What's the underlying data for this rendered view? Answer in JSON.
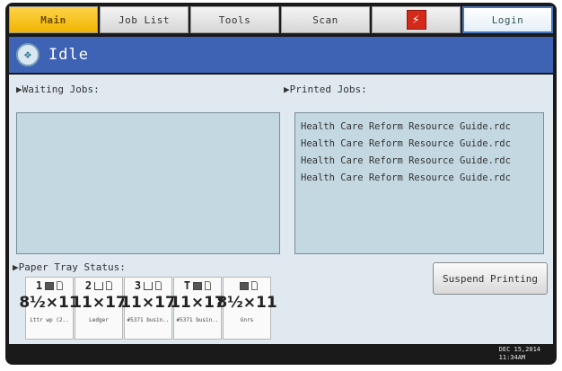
{
  "tabs": [
    {
      "label": "Main",
      "active": true
    },
    {
      "label": "Job List"
    },
    {
      "label": "Tools"
    },
    {
      "label": "Scan"
    },
    {
      "label": "",
      "icon": "alert-icon"
    },
    {
      "label": "Login"
    }
  ],
  "status": {
    "text": "Idle",
    "icon": "printer-status-icon"
  },
  "waiting_jobs": {
    "label": "▶Waiting Jobs:"
  },
  "printed_jobs": {
    "label": "▶Printed Jobs:",
    "items": [
      "Health Care Reform Resource Guide.rdc",
      "Health Care Reform Resource Guide.rdc",
      "Health Care Reform Resource Guide.rdc",
      "Health Care Reform Resource Guide.rdc"
    ]
  },
  "paper_tray": {
    "label": "▶Paper Tray Status:",
    "trays": [
      {
        "num": "1",
        "size": "8½×11",
        "type": "Lttr wp (2.."
      },
      {
        "num": "2",
        "size": "11×17",
        "type": "Ledger"
      },
      {
        "num": "3",
        "size": "11×17",
        "type": "#5371 busin.."
      },
      {
        "num": "T",
        "size": "11×17",
        "type": "#5371 busin.."
      },
      {
        "num": "",
        "size": "8½×11",
        "type": "Gnrs"
      }
    ]
  },
  "suspend_label": "Suspend Printing",
  "datetime": {
    "date": "DEC 15,2014",
    "time": "11:34AM"
  },
  "colors": {
    "accent": "#3e62b4",
    "active_tab": "#f0b400",
    "panel": "#c4d8e2"
  }
}
